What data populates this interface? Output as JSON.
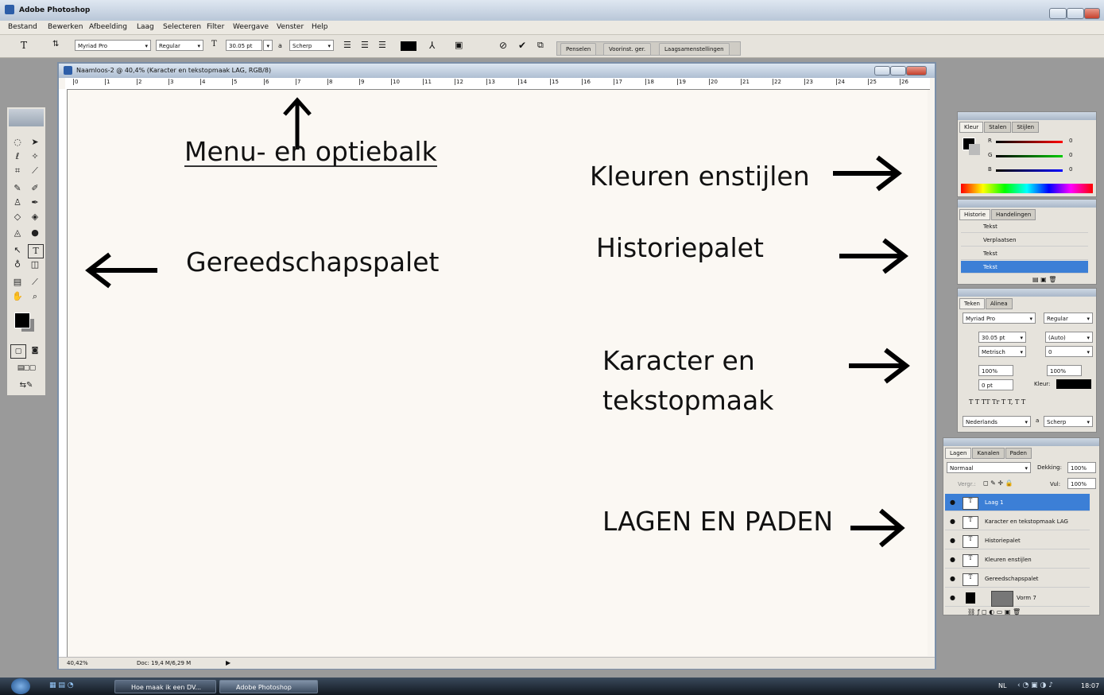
{
  "app": {
    "title": "Adobe Photoshop"
  },
  "menu": [
    "Bestand",
    "Bewerken",
    "Afbeelding",
    "Laag",
    "Selecteren",
    "Filter",
    "Weergave",
    "Venster",
    "Help"
  ],
  "options": {
    "font_family": "Myriad Pro",
    "font_style": "Regular",
    "font_size": "30.05 pt",
    "antialias_icon": "a",
    "antialias": "Scherp",
    "palette_tabs": [
      "Penselen",
      "Voorinst. ger.",
      "Laagsamenstellingen"
    ]
  },
  "document": {
    "title": "Naamloos-2 @ 40,4% (Karacter en  tekstopmaak  LAG, RGB/8)",
    "ruler_marks": [
      "0",
      "1",
      "2",
      "3",
      "4",
      "5",
      "6",
      "7",
      "8",
      "9",
      "10",
      "11",
      "12",
      "13",
      "14",
      "15",
      "16",
      "17",
      "18",
      "19",
      "20",
      "21",
      "22",
      "23",
      "24",
      "25",
      "26"
    ],
    "zoom": "40,42%",
    "doc_info": "Doc: 19,4 M/6,29 M"
  },
  "annotations": {
    "menu": "Menu- en optiebalk",
    "colors": "Kleuren enstijlen",
    "tools": "Gereedschapspalet",
    "history": "Historiepalet",
    "char1": "Karacter en",
    "char2": "tekstopmaak",
    "layers": "LAGEN EN PADEN"
  },
  "color_panel": {
    "tabs": [
      "Kleur",
      "Stalen",
      "Stijlen"
    ],
    "channels": [
      {
        "label": "R",
        "value": "0"
      },
      {
        "label": "G",
        "value": "0"
      },
      {
        "label": "B",
        "value": "0"
      }
    ]
  },
  "history_panel": {
    "tabs": [
      "Historie",
      "Handelingen"
    ],
    "items": [
      "Tekst",
      "Verplaatsen",
      "Tekst",
      "Tekst"
    ]
  },
  "char_panel": {
    "tabs": [
      "Teken",
      "Alinea"
    ],
    "font": "Myriad Pro",
    "style": "Regular",
    "size": "30.05 pt",
    "leading": "(Auto)",
    "kerning": "Metrisch",
    "tracking": "0",
    "vscale": "100%",
    "hscale": "100%",
    "baseline": "0 pt",
    "color_label": "Kleur:",
    "type_buttons": "T  T  TT  Tr  T  T,  T  T",
    "language": "Nederlands",
    "antialias_icon": "a",
    "antialias": "Scherp"
  },
  "layers_panel": {
    "tabs": [
      "Lagen",
      "Kanalen",
      "Paden"
    ],
    "blend": "Normaal",
    "opacity_label": "Dekking:",
    "opacity": "100%",
    "lock_label": "Vergr.:",
    "fill_label": "Vul:",
    "fill": "100%",
    "layers": [
      "Laag 1",
      "Karacter en  tekstopmaak  LAG",
      "Historiepalet",
      "Kleuren enstijlen",
      "Gereedschapspalet",
      "Vorm 7"
    ]
  },
  "taskbar": {
    "buttons": [
      "Hoe maak ik een DV...",
      "Adobe Photoshop"
    ],
    "lang": "NL",
    "time": "18:07"
  },
  "colors": {
    "accent": "#3c7fd6",
    "bg": "#9a9a9a"
  }
}
